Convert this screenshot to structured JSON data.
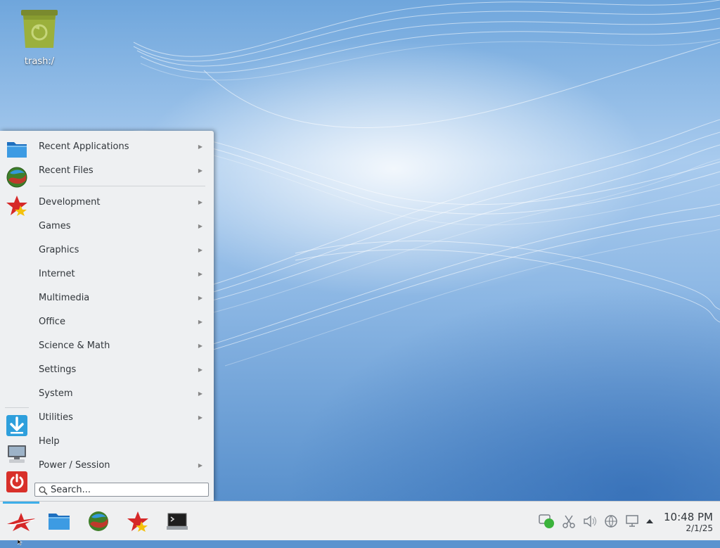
{
  "desktop": {
    "trash_label": "trash:/"
  },
  "menu": {
    "items": [
      {
        "label": "Recent Applications",
        "submenu": true
      },
      {
        "label": "Recent Files",
        "submenu": true
      },
      {
        "label": "Development",
        "submenu": true
      },
      {
        "label": "Games",
        "submenu": true
      },
      {
        "label": "Graphics",
        "submenu": true
      },
      {
        "label": "Internet",
        "submenu": true
      },
      {
        "label": "Multimedia",
        "submenu": true
      },
      {
        "label": "Office",
        "submenu": true
      },
      {
        "label": "Science & Math",
        "submenu": true
      },
      {
        "label": "Settings",
        "submenu": true
      },
      {
        "label": "System",
        "submenu": true
      },
      {
        "label": "Utilities",
        "submenu": true
      },
      {
        "label": "Help",
        "submenu": false
      },
      {
        "label": "Power / Session",
        "submenu": true
      }
    ],
    "search_placeholder": "Search...",
    "side_icons": [
      "folder-icon",
      "globe-browser-icon",
      "kde-favorites-star-icon",
      "download-icon",
      "computer-icon",
      "power-icon"
    ]
  },
  "taskbar": {
    "launchers": [
      "app-launcher-icon",
      "file-manager-icon",
      "web-browser-icon",
      "software-center-icon",
      "terminal-icon"
    ],
    "tray": [
      "updates-icon",
      "clipboard-icon",
      "volume-icon",
      "network-icon",
      "device-icon",
      "tray-expand-icon"
    ],
    "clock": {
      "time": "10:48 PM",
      "date": "2/1/25"
    }
  },
  "colors": {
    "accent": "#3daee9",
    "panel_bg": "#eff0f1",
    "menu_bg": "#eef0f2",
    "text": "#31363b"
  }
}
